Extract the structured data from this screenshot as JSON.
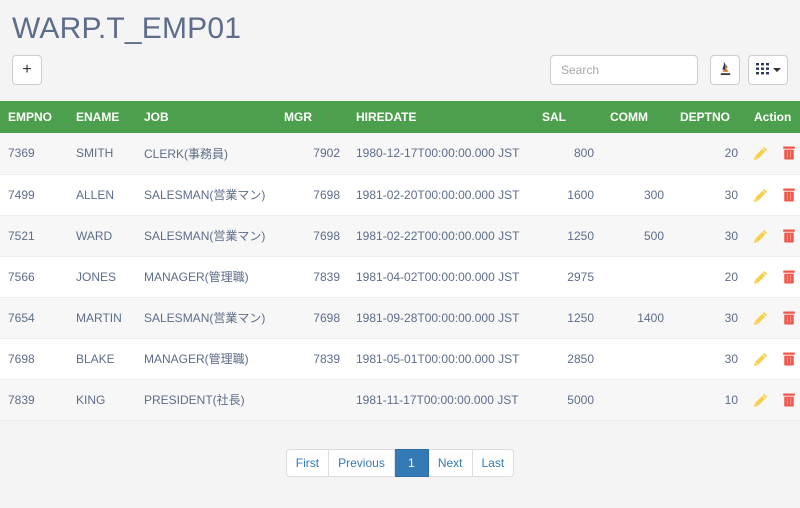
{
  "header": {
    "title": "WARP.T_EMP01"
  },
  "toolbar": {
    "add_label": "+",
    "search_placeholder": "Search",
    "export_icon": "export-icon",
    "columns_icon": "grid-columns-icon"
  },
  "table": {
    "columns": [
      {
        "key": "empno",
        "label": "EMPNO",
        "align": "left"
      },
      {
        "key": "ename",
        "label": "ENAME",
        "align": "left"
      },
      {
        "key": "job",
        "label": "JOB",
        "align": "left"
      },
      {
        "key": "mgr",
        "label": "MGR",
        "align": "right"
      },
      {
        "key": "hiredate",
        "label": "HIREDATE",
        "align": "left"
      },
      {
        "key": "sal",
        "label": "SAL",
        "align": "right"
      },
      {
        "key": "comm",
        "label": "COMM",
        "align": "right"
      },
      {
        "key": "deptno",
        "label": "DEPTNO",
        "align": "right"
      },
      {
        "key": "action",
        "label": "Action",
        "align": "left"
      }
    ],
    "rows": [
      {
        "empno": "7369",
        "ename": "SMITH",
        "job": "CLERK(事務員)",
        "mgr": "7902",
        "hiredate": "1980-12-17T00:00:00.000 JST",
        "sal": "800",
        "comm": "",
        "deptno": "20"
      },
      {
        "empno": "7499",
        "ename": "ALLEN",
        "job": "SALESMAN(営業マン)",
        "mgr": "7698",
        "hiredate": "1981-02-20T00:00:00.000 JST",
        "sal": "1600",
        "comm": "300",
        "deptno": "30"
      },
      {
        "empno": "7521",
        "ename": "WARD",
        "job": "SALESMAN(営業マン)",
        "mgr": "7698",
        "hiredate": "1981-02-22T00:00:00.000 JST",
        "sal": "1250",
        "comm": "500",
        "deptno": "30"
      },
      {
        "empno": "7566",
        "ename": "JONES",
        "job": "MANAGER(管理職)",
        "mgr": "7839",
        "hiredate": "1981-04-02T00:00:00.000 JST",
        "sal": "2975",
        "comm": "",
        "deptno": "20"
      },
      {
        "empno": "7654",
        "ename": "MARTIN",
        "job": "SALESMAN(営業マン)",
        "mgr": "7698",
        "hiredate": "1981-09-28T00:00:00.000 JST",
        "sal": "1250",
        "comm": "1400",
        "deptno": "30"
      },
      {
        "empno": "7698",
        "ename": "BLAKE",
        "job": "MANAGER(管理職)",
        "mgr": "7839",
        "hiredate": "1981-05-01T00:00:00.000 JST",
        "sal": "2850",
        "comm": "",
        "deptno": "30"
      },
      {
        "empno": "7839",
        "ename": "KING",
        "job": "PRESIDENT(社長)",
        "mgr": "",
        "hiredate": "1981-11-17T00:00:00.000 JST",
        "sal": "5000",
        "comm": "",
        "deptno": "10"
      }
    ],
    "row_actions": {
      "edit_icon": "pencil-edit-icon",
      "delete_icon": "trash-delete-icon"
    }
  },
  "pagination": {
    "items": [
      {
        "label": "First",
        "active": false
      },
      {
        "label": "Previous",
        "active": false
      },
      {
        "label": "1",
        "active": true
      },
      {
        "label": "Next",
        "active": false
      },
      {
        "label": "Last",
        "active": false
      }
    ]
  },
  "colors": {
    "header_green": "#4c9f4c",
    "title_blue": "#5d6d8a",
    "cell_text": "#5d6d8a",
    "page_background": "#f4f4f4",
    "pager_active": "#337ab7",
    "edit_icon": "#f7d04a",
    "delete_icon": "#f0564a"
  }
}
